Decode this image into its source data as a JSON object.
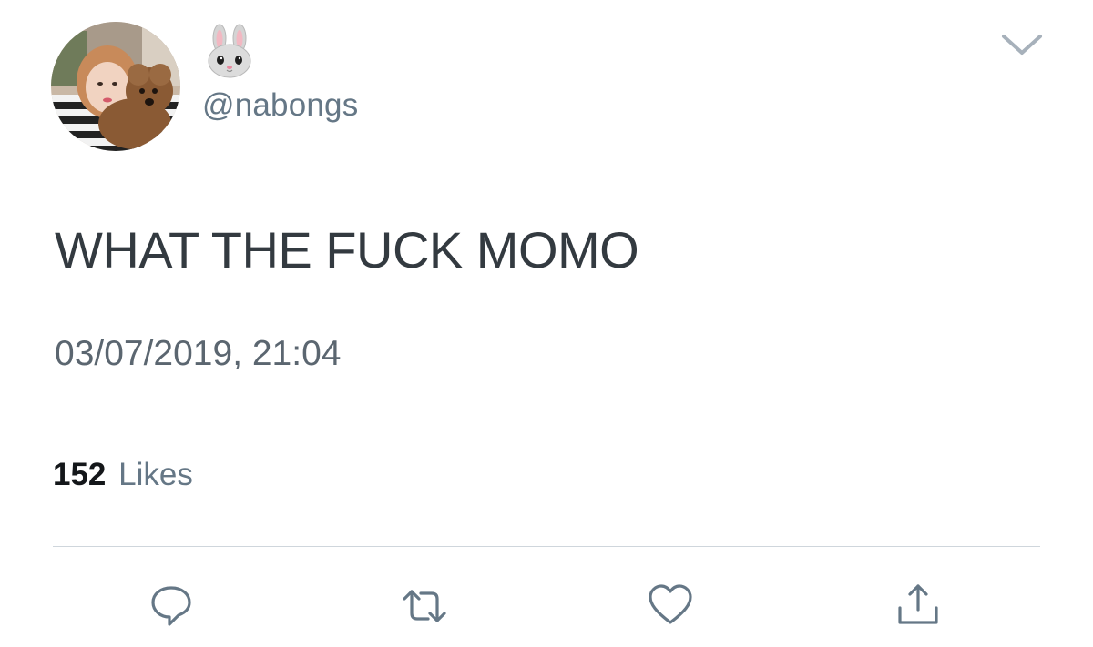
{
  "tweet": {
    "display_name_icon": "rabbit-face-emoji",
    "handle": "@nabongs",
    "text": "WHAT THE FUCK MOMO",
    "timestamp": "03/07/2019, 21:04",
    "likes_count": "152",
    "likes_label": "Likes"
  },
  "icons": {
    "menu": "chevron-down-icon",
    "reply": "reply-icon",
    "retweet": "retweet-icon",
    "like": "heart-icon",
    "share": "share-icon"
  },
  "colors": {
    "primary_text": "#14171a",
    "secondary_text": "#657786",
    "divider": "#cfd6dc",
    "icon": "#657786"
  }
}
